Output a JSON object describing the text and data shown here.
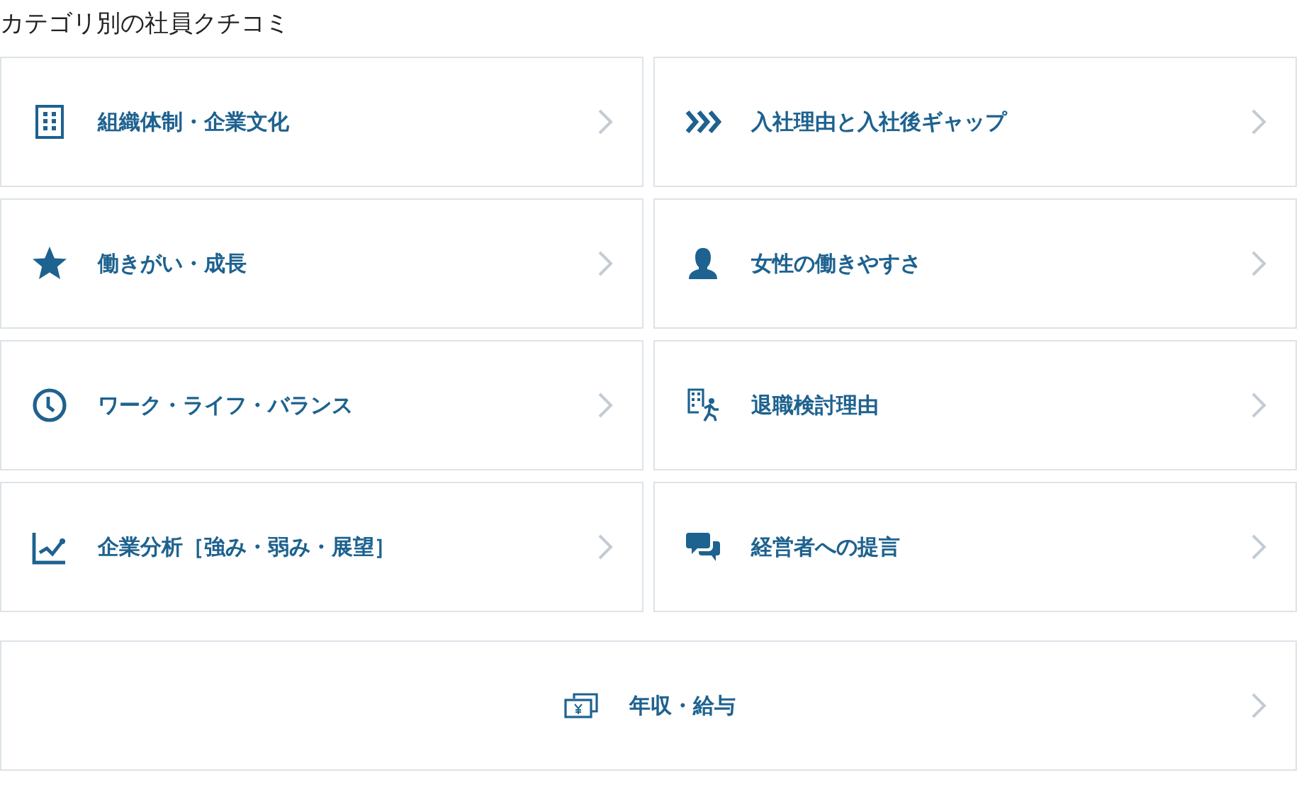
{
  "heading": "カテゴリ別の社員クチコミ",
  "categories": [
    {
      "label": "組織体制・企業文化"
    },
    {
      "label": "入社理由と入社後ギャップ"
    },
    {
      "label": "働きがい・成長"
    },
    {
      "label": "女性の働きやすさ"
    },
    {
      "label": "ワーク・ライフ・バランス"
    },
    {
      "label": "退職検討理由"
    },
    {
      "label": "企業分析［強み・弱み・展望］"
    },
    {
      "label": "経営者への提言"
    }
  ],
  "footer_category": {
    "label": "年収・給与"
  }
}
